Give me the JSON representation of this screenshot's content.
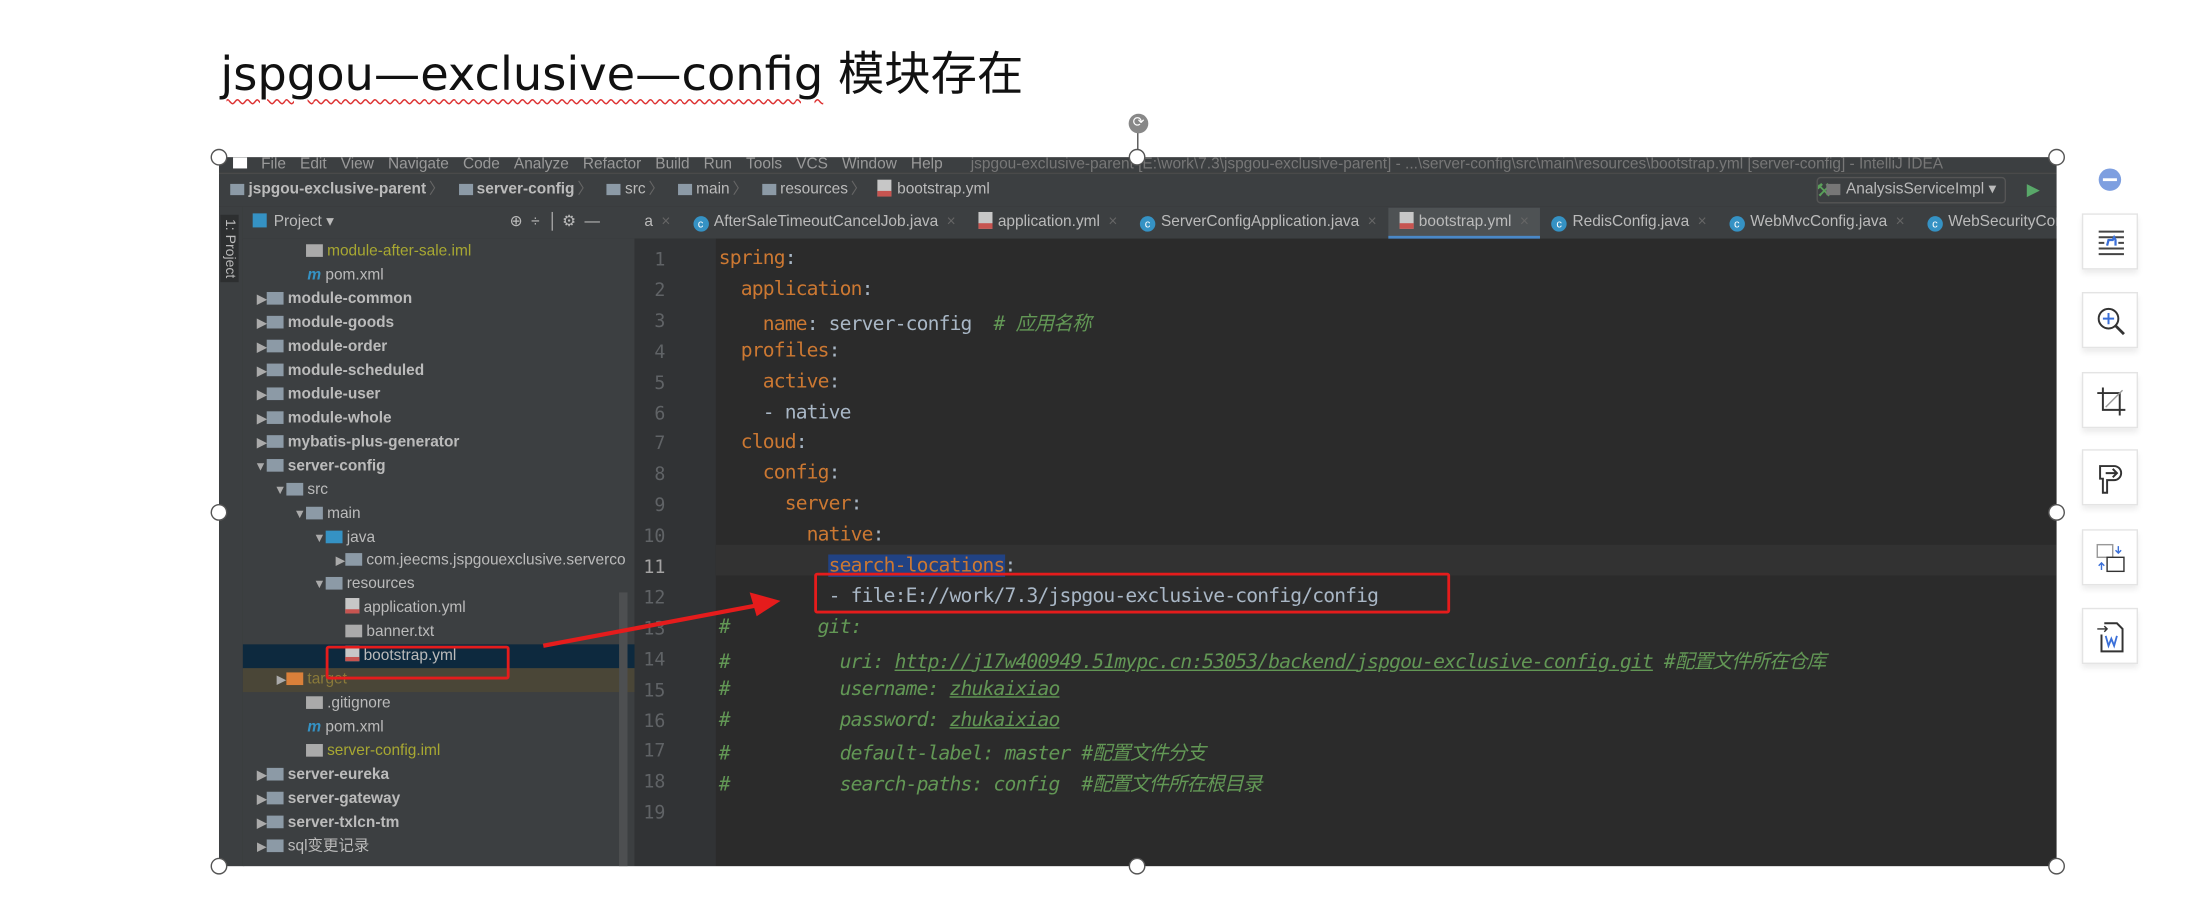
{
  "doc_title": {
    "latin": "jspgou—exclusive—config",
    "cjk": " 模块存在"
  },
  "ide": {
    "menu": [
      "File",
      "Edit",
      "View",
      "Navigate",
      "Code",
      "Analyze",
      "Refactor",
      "Build",
      "Run",
      "Tools",
      "VCS",
      "Window",
      "Help"
    ],
    "window_title": "jspgou-exclusive-parent [E:\\work\\7.3\\jspgou-exclusive-parent] - ...\\server-config\\src\\main\\resources\\bootstrap.yml [server-config] - IntelliJ IDEA",
    "breadcrumbs": [
      "jspgou-exclusive-parent",
      "server-config",
      "src",
      "main",
      "resources",
      "bootstrap.yml"
    ],
    "run_config": "AnalysisServiceImpl",
    "side_stripe_label": "1: Project",
    "project_header": "Project",
    "tabs": [
      {
        "label": "a",
        "icon": "truncated"
      },
      {
        "label": "AfterSaleTimeoutCancelJob.java",
        "icon": "class-icon"
      },
      {
        "label": "application.yml",
        "icon": "yml-icon"
      },
      {
        "label": "ServerConfigApplication.java",
        "icon": "class-icon"
      },
      {
        "label": "bootstrap.yml",
        "icon": "yml-icon",
        "active": true
      },
      {
        "label": "RedisConfig.java",
        "icon": "class-icon"
      },
      {
        "label": "WebMvcConfig.java",
        "icon": "class-icon"
      },
      {
        "label": "WebSecurityConfig.java",
        "icon": "class-icon"
      }
    ],
    "tree": [
      {
        "label": "module-after-sale.iml",
        "depth": 2,
        "kind": "iml"
      },
      {
        "label": "pom.xml",
        "depth": 2,
        "kind": "maven"
      },
      {
        "label": "module-common",
        "depth": 0,
        "kind": "module",
        "arrow": "right"
      },
      {
        "label": "module-goods",
        "depth": 0,
        "kind": "module",
        "arrow": "right"
      },
      {
        "label": "module-order",
        "depth": 0,
        "kind": "module",
        "arrow": "right"
      },
      {
        "label": "module-scheduled",
        "depth": 0,
        "kind": "module",
        "arrow": "right"
      },
      {
        "label": "module-user",
        "depth": 0,
        "kind": "module",
        "arrow": "right"
      },
      {
        "label": "module-whole",
        "depth": 0,
        "kind": "module",
        "arrow": "right"
      },
      {
        "label": "mybatis-plus-generator",
        "depth": 0,
        "kind": "module",
        "arrow": "right"
      },
      {
        "label": "server-config",
        "depth": 0,
        "kind": "module",
        "arrow": "down"
      },
      {
        "label": "src",
        "depth": 1,
        "kind": "folder",
        "arrow": "down"
      },
      {
        "label": "main",
        "depth": 2,
        "kind": "folder",
        "arrow": "down"
      },
      {
        "label": "java",
        "depth": 3,
        "kind": "source",
        "arrow": "down"
      },
      {
        "label": "com.jeecms.jspgouexclusive.serverco",
        "depth": 4,
        "kind": "package",
        "arrow": "right"
      },
      {
        "label": "resources",
        "depth": 3,
        "kind": "resources",
        "arrow": "down"
      },
      {
        "label": "application.yml",
        "depth": 4,
        "kind": "yml"
      },
      {
        "label": "banner.txt",
        "depth": 4,
        "kind": "txt"
      },
      {
        "label": "bootstrap.yml",
        "depth": 4,
        "kind": "yml",
        "selected": true
      },
      {
        "label": "target",
        "depth": 1,
        "kind": "target",
        "arrow": "right"
      },
      {
        "label": ".gitignore",
        "depth": 2,
        "kind": "ignore"
      },
      {
        "label": "pom.xml",
        "depth": 2,
        "kind": "maven"
      },
      {
        "label": "server-config.iml",
        "depth": 2,
        "kind": "iml"
      },
      {
        "label": "server-eureka",
        "depth": 0,
        "kind": "module",
        "arrow": "right"
      },
      {
        "label": "server-gateway",
        "depth": 0,
        "kind": "module",
        "arrow": "right"
      },
      {
        "label": "server-txlcn-tm",
        "depth": 0,
        "kind": "module",
        "arrow": "right"
      },
      {
        "label": "sql变更记录",
        "depth": 0,
        "kind": "folder",
        "arrow": "right"
      }
    ],
    "code": [
      {
        "n": "1",
        "indent": "",
        "key": "spring",
        "rest": ":"
      },
      {
        "n": "2",
        "indent": "  ",
        "key": "application",
        "rest": ":"
      },
      {
        "n": "3",
        "indent": "    ",
        "key": "name",
        "rest": ": server-config  ",
        "comment": "# 应用名称"
      },
      {
        "n": "4",
        "indent": "  ",
        "key": "profiles",
        "rest": ":"
      },
      {
        "n": "5",
        "indent": "    ",
        "key": "active",
        "rest": ":"
      },
      {
        "n": "6",
        "indent": "    ",
        "key": "",
        "rest": "- native"
      },
      {
        "n": "7",
        "indent": "  ",
        "key": "cloud",
        "rest": ":"
      },
      {
        "n": "8",
        "indent": "    ",
        "key": "config",
        "rest": ":"
      },
      {
        "n": "9",
        "indent": "      ",
        "key": "server",
        "rest": ":"
      },
      {
        "n": "10",
        "indent": "        ",
        "key": "native",
        "rest": ":"
      },
      {
        "n": "11",
        "indent": "          ",
        "key": "search-locations",
        "rest": ":",
        "highlight": true
      },
      {
        "n": "12",
        "indent": "          ",
        "key": "",
        "rest": "- file:E://work/7.3/jspgou-exclusive-config/config"
      },
      {
        "n": "13",
        "indent": "",
        "comment": "#        git:"
      },
      {
        "n": "14",
        "indent": "",
        "comment": "#          uri: ",
        "link": "http://j17w400949.51mypc.cn:53053/backend/jspgou-exclusive-config.git",
        "comment2": " #配置文件所在仓库"
      },
      {
        "n": "15",
        "indent": "",
        "comment": "#          username: ",
        "link": "zhukaixiao"
      },
      {
        "n": "16",
        "indent": "",
        "comment": "#          password: ",
        "link": "zhukaixiao"
      },
      {
        "n": "17",
        "indent": "",
        "comment": "#          default-label: master #配置文件分支"
      },
      {
        "n": "18",
        "indent": "",
        "comment": "#          search-paths: config  #配置文件所在根目录"
      },
      {
        "n": "19",
        "indent": "",
        "rest": ""
      }
    ]
  },
  "annotation_color": "#e51c1c",
  "side_toolbar": [
    "collapse-icon",
    "wrap-text-icon",
    "zoom-in-icon",
    "crop-icon",
    "convert-icon",
    "replace-image-icon",
    "image-to-word-icon"
  ]
}
